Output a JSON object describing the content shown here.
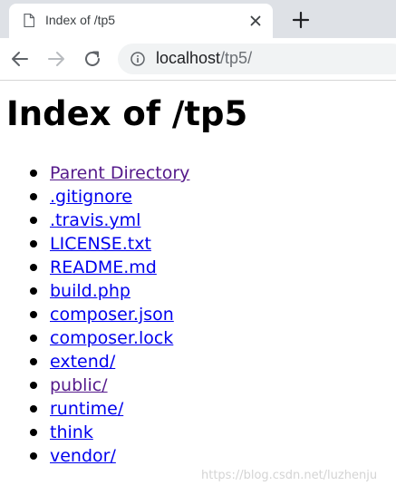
{
  "browser": {
    "tab": {
      "title": "Index of /tp5",
      "page_icon": "document-icon",
      "close_icon": "close-icon"
    },
    "new_tab_icon": "plus-icon",
    "toolbar": {
      "back_icon": "arrow-left-icon",
      "forward_icon": "arrow-right-icon",
      "reload_icon": "reload-icon",
      "info_icon": "info-icon"
    },
    "address": {
      "host": "localhost",
      "path": "/tp5/"
    }
  },
  "page": {
    "heading": "Index of /tp5",
    "entries": [
      {
        "label": "Parent Directory",
        "visited": true
      },
      {
        "label": ".gitignore",
        "visited": false
      },
      {
        "label": ".travis.yml",
        "visited": false
      },
      {
        "label": "LICENSE.txt",
        "visited": false
      },
      {
        "label": "README.md",
        "visited": false
      },
      {
        "label": "build.php",
        "visited": false
      },
      {
        "label": "composer.json",
        "visited": false
      },
      {
        "label": "composer.lock",
        "visited": false
      },
      {
        "label": "extend/",
        "visited": false
      },
      {
        "label": "public/",
        "visited": true
      },
      {
        "label": "runtime/",
        "visited": false
      },
      {
        "label": "think",
        "visited": false
      },
      {
        "label": "vendor/",
        "visited": false
      }
    ]
  },
  "watermark": "https://blog.csdn.net/luzhenju",
  "colors": {
    "tabstrip_bg": "#dee1e6",
    "link_unvisited": "#0000ee",
    "link_visited": "#551a8b",
    "omnibox_bg": "#f1f3f4"
  }
}
